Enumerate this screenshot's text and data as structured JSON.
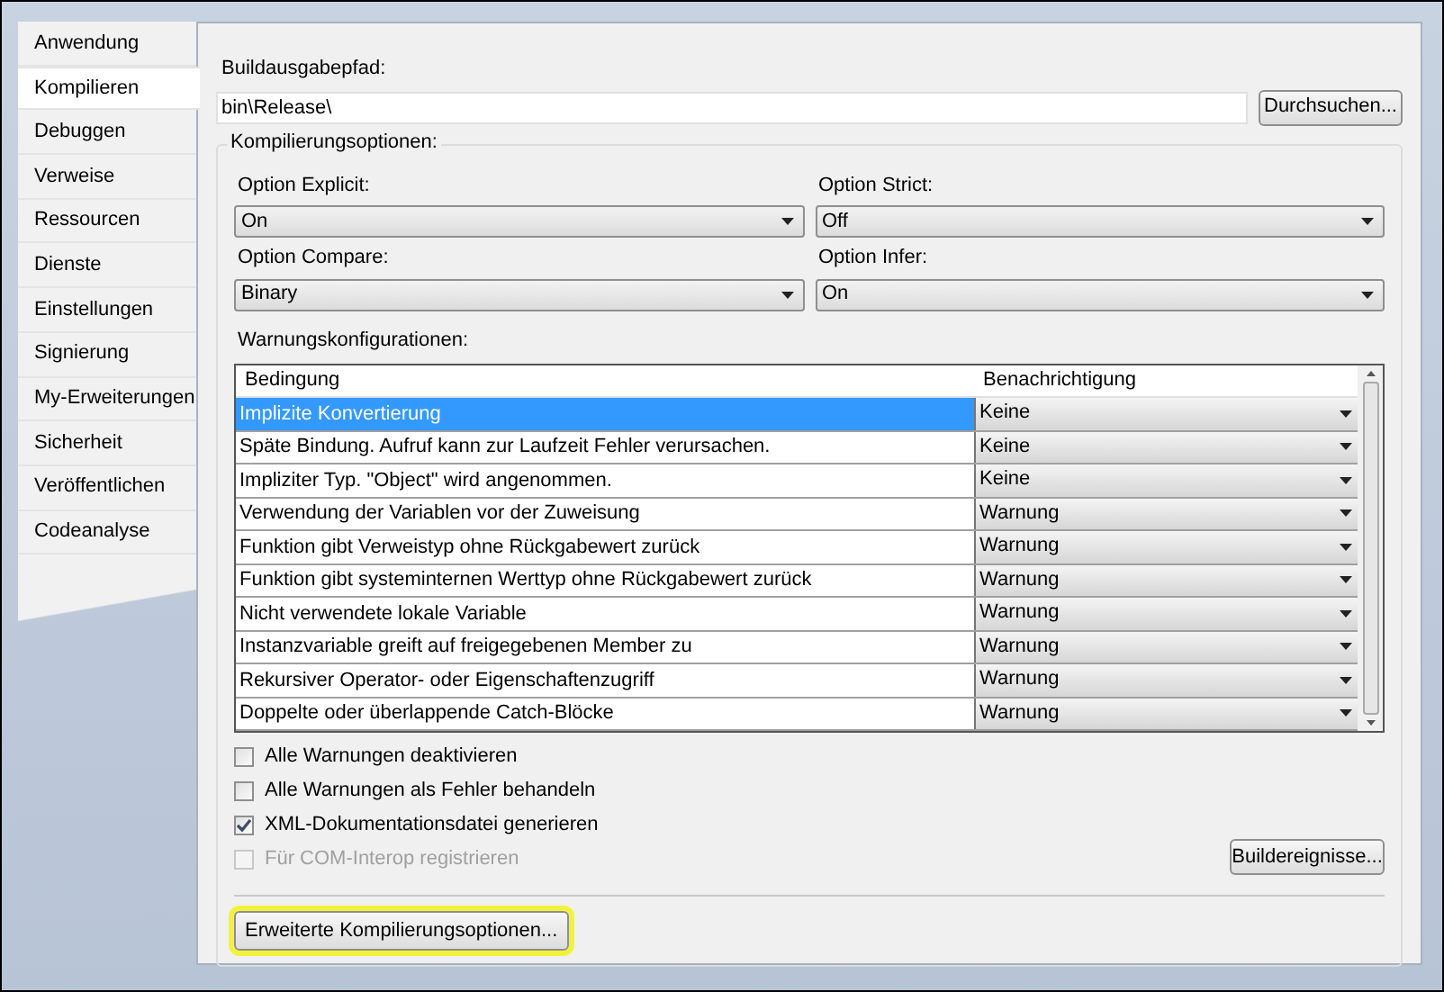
{
  "sidebar": {
    "items": [
      {
        "label": "Anwendung",
        "selected": false
      },
      {
        "label": "Kompilieren",
        "selected": true
      },
      {
        "label": "Debuggen",
        "selected": false
      },
      {
        "label": "Verweise",
        "selected": false
      },
      {
        "label": "Ressourcen",
        "selected": false
      },
      {
        "label": "Dienste",
        "selected": false
      },
      {
        "label": "Einstellungen",
        "selected": false
      },
      {
        "label": "Signierung",
        "selected": false
      },
      {
        "label": "My-Erweiterungen",
        "selected": false
      },
      {
        "label": "Sicherheit",
        "selected": false
      },
      {
        "label": "Veröffentlichen",
        "selected": false
      },
      {
        "label": "Codeanalyse",
        "selected": false
      }
    ]
  },
  "build_output": {
    "label": "Buildausgabepfad:",
    "value": "bin\\Release\\",
    "browse_button": "Durchsuchen..."
  },
  "compile_options": {
    "title": "Kompilierungsoptionen:",
    "options": [
      {
        "label": "Option Explicit:",
        "value": "On"
      },
      {
        "label": "Option Strict:",
        "value": "Off"
      },
      {
        "label": "Option Compare:",
        "value": "Binary"
      },
      {
        "label": "Option Infer:",
        "value": "On"
      }
    ],
    "warnings_label": "Warnungskonfigurationen:",
    "table": {
      "columns": [
        "Bedingung",
        "Benachrichtigung"
      ],
      "rows": [
        {
          "condition": "Implizite Konvertierung",
          "notification": "Keine",
          "selected": true
        },
        {
          "condition": "Späte Bindung. Aufruf kann zur Laufzeit Fehler verursachen.",
          "notification": "Keine",
          "selected": false
        },
        {
          "condition": "Impliziter Typ. \"Object\" wird angenommen.",
          "notification": "Keine",
          "selected": false
        },
        {
          "condition": "Verwendung der Variablen vor der Zuweisung",
          "notification": "Warnung",
          "selected": false
        },
        {
          "condition": "Funktion gibt Verweistyp ohne Rückgabewert zurück",
          "notification": "Warnung",
          "selected": false
        },
        {
          "condition": "Funktion gibt systeminternen Werttyp ohne Rückgabewert zurück",
          "notification": "Warnung",
          "selected": false
        },
        {
          "condition": "Nicht verwendete lokale Variable",
          "notification": "Warnung",
          "selected": false
        },
        {
          "condition": "Instanzvariable greift auf freigegebenen Member zu",
          "notification": "Warnung",
          "selected": false
        },
        {
          "condition": "Rekursiver Operator- oder Eigenschaftenzugriff",
          "notification": "Warnung",
          "selected": false
        },
        {
          "condition": "Doppelte oder überlappende Catch-Blöcke",
          "notification": "Warnung",
          "selected": false
        }
      ]
    },
    "checkboxes": [
      {
        "label": "Alle Warnungen deaktivieren",
        "checked": false,
        "disabled": false
      },
      {
        "label": "Alle Warnungen als Fehler behandeln",
        "checked": false,
        "disabled": false
      },
      {
        "label": "XML-Dokumentationsdatei generieren",
        "checked": true,
        "disabled": false
      },
      {
        "label": "Für COM-Interop registrieren",
        "checked": false,
        "disabled": true
      }
    ],
    "build_events_button": "Buildereignisse..."
  },
  "advanced_button": {
    "label": "Erweiterte Kompilierungsoptionen...",
    "highlighted": true
  }
}
